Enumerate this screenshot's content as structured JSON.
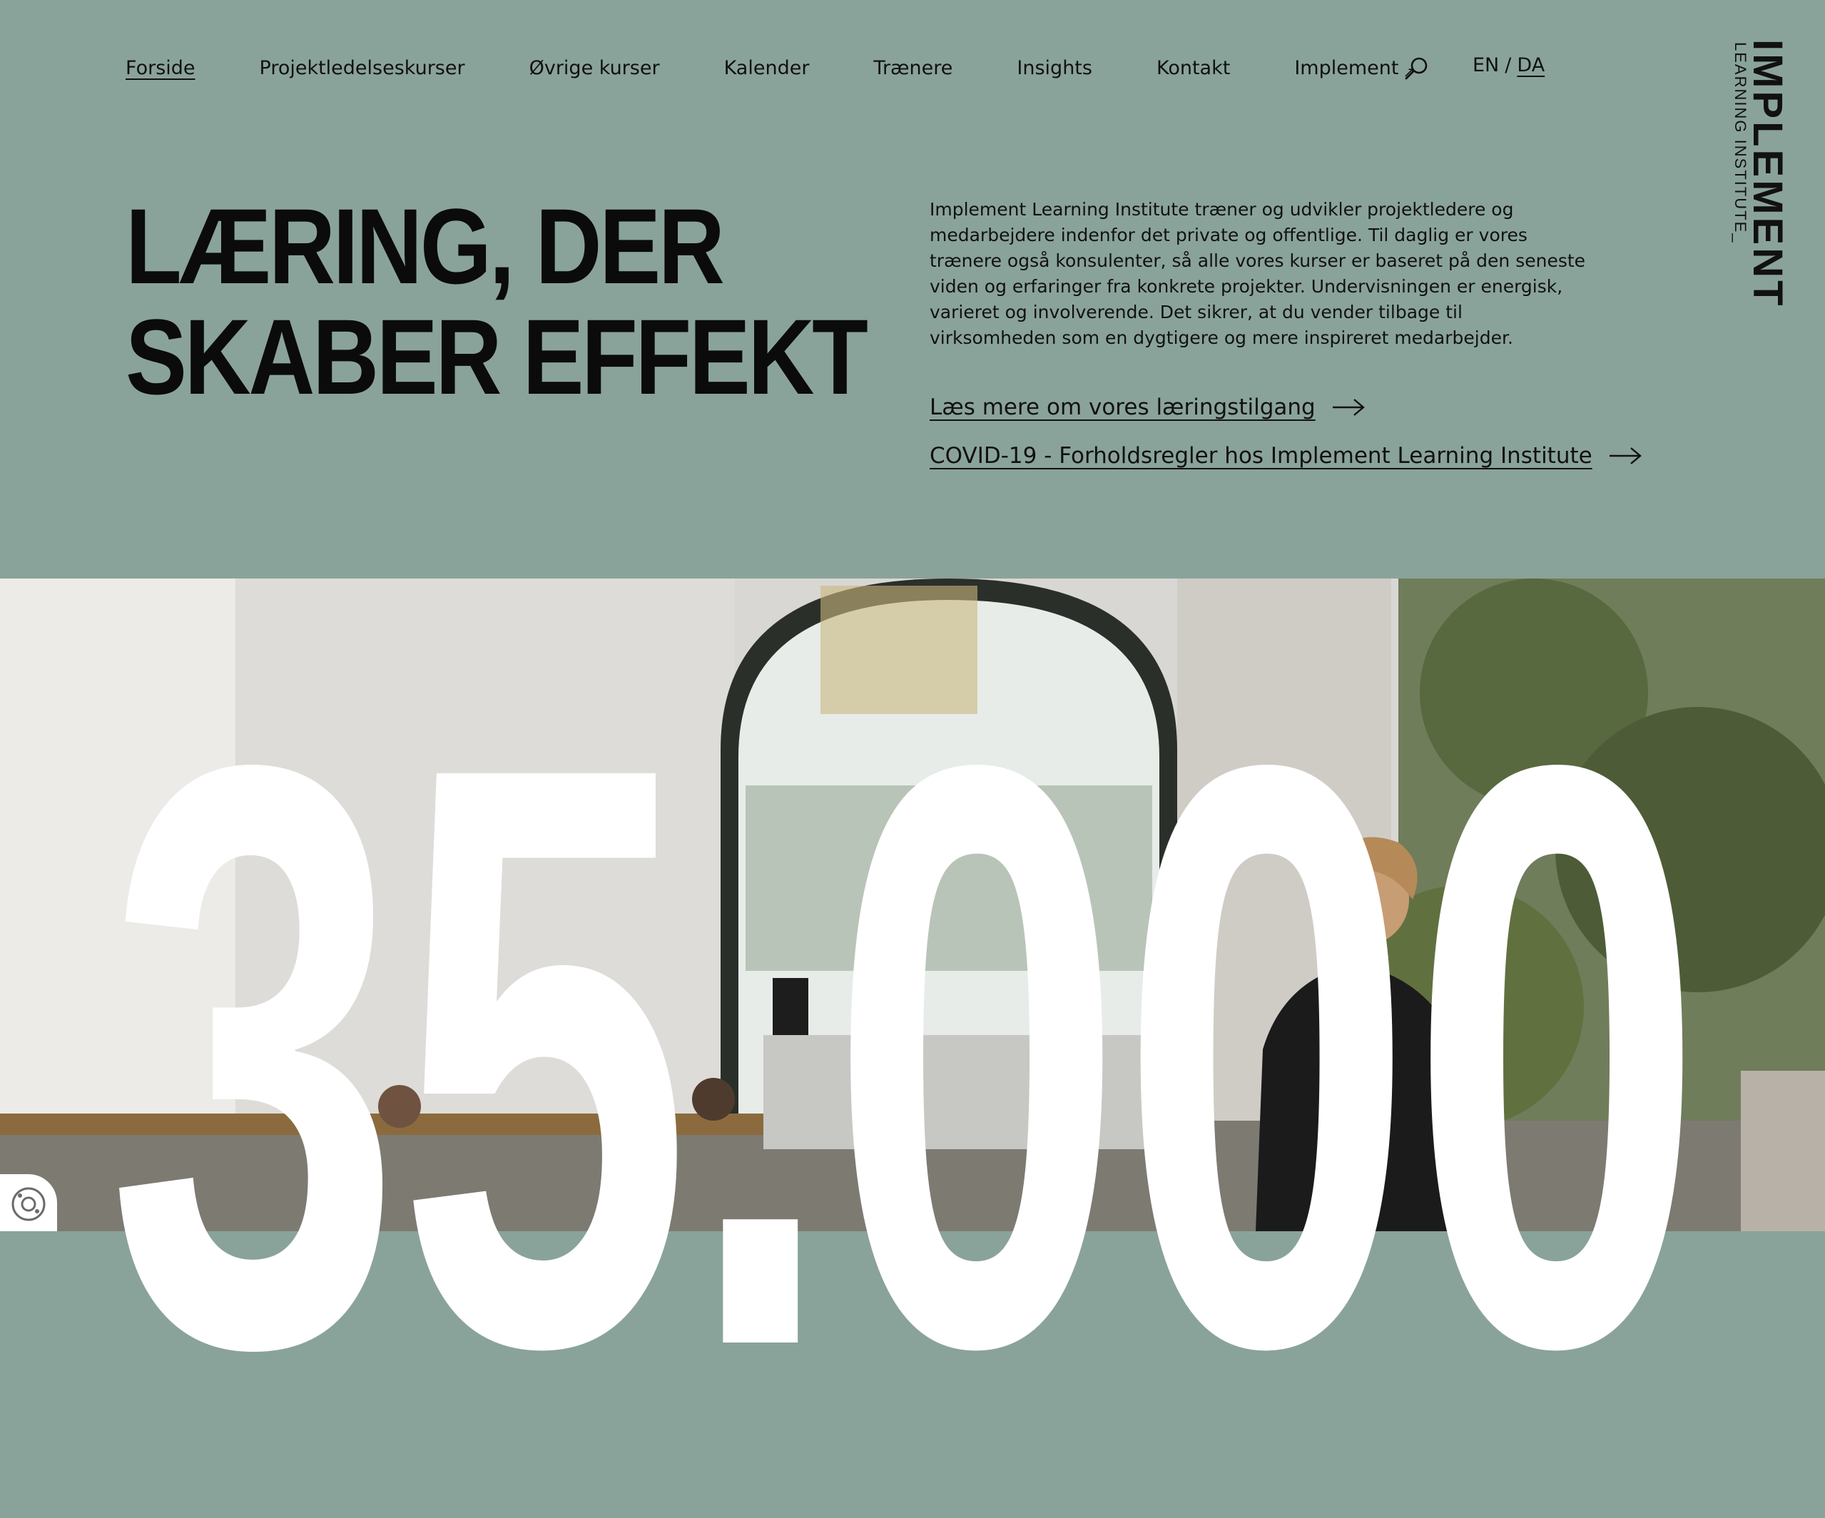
{
  "nav": {
    "items": [
      {
        "label": "Forside",
        "active": true
      },
      {
        "label": "Projektledelseskurser"
      },
      {
        "label": "Øvrige kurser"
      },
      {
        "label": "Kalender"
      },
      {
        "label": "Trænere"
      },
      {
        "label": "Insights"
      },
      {
        "label": "Kontakt"
      },
      {
        "label": "Implement",
        "external": true
      }
    ],
    "search_icon": "search-icon",
    "lang_en": "EN",
    "lang_sep": "/",
    "lang_da": "DA"
  },
  "logo": {
    "main": "IMPLEMENT",
    "sub": "LEARNING INSTITUTE_"
  },
  "hero": {
    "title_line1": "LÆRING, DER",
    "title_line2": "SKABER EFFEKT",
    "intro": "Implement Learning Institute træner og udvikler projektledere og medarbejdere indenfor det private og offentlige. Til daglig er vores trænere også konsulenter, så alle vores kurser er baseret på den seneste viden og erfaringer fra konkrete projekter. Undervisningen er energisk, varieret og involverende. Det sikrer, at du vender tilbage til virksomheden som en dygtigere og mere inspireret medarbejder.",
    "link1": "Læs mere om vores læringstilgang",
    "link2": "COVID-19 - Forholdsregler hos Implement Learning Institute"
  },
  "stat": {
    "number": "35.000"
  },
  "colors": {
    "header_bg": "#8aa39a",
    "text": "#111111",
    "stat_text": "#ffffff"
  }
}
